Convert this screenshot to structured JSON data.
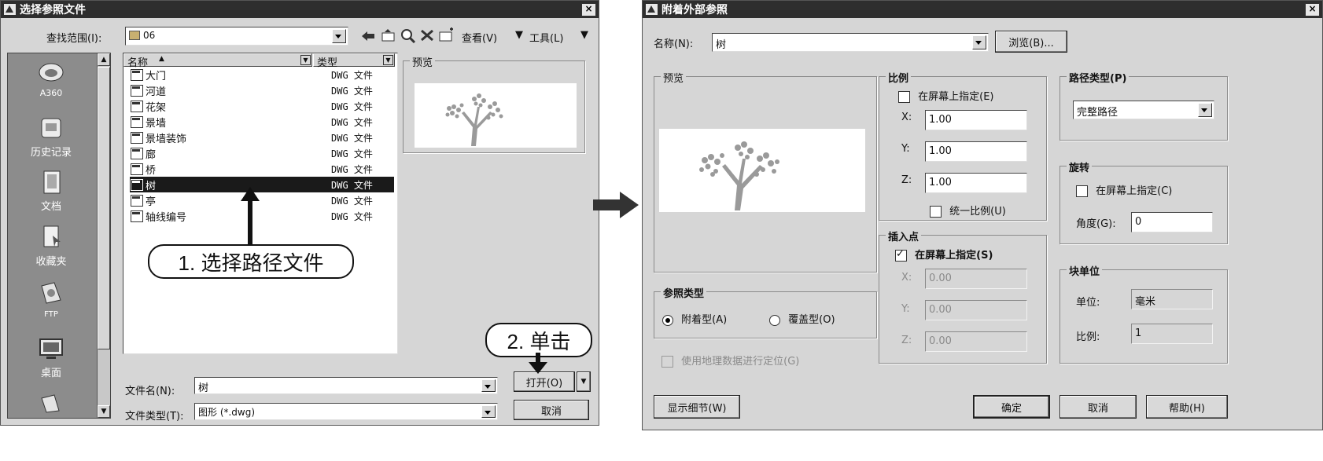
{
  "left_dialog": {
    "title": "选择参照文件",
    "close": "×",
    "lookin_label": "查找范围(I):",
    "lookin_value": "06",
    "view_menu": "查看(V)",
    "tools_menu": "工具(L)",
    "places": [
      "A360",
      "历史记录",
      "文档",
      "收藏夹",
      "FTP",
      "桌面"
    ],
    "col_name": "名称",
    "col_type": "类型",
    "files": [
      {
        "name": "大门",
        "type": "DWG 文件"
      },
      {
        "name": "河道",
        "type": "DWG 文件"
      },
      {
        "name": "花架",
        "type": "DWG 文件"
      },
      {
        "name": "景墙",
        "type": "DWG 文件"
      },
      {
        "name": "景墙装饰",
        "type": "DWG 文件"
      },
      {
        "name": "廊",
        "type": "DWG 文件"
      },
      {
        "name": "桥",
        "type": "DWG 文件"
      },
      {
        "name": "树",
        "type": "DWG 文件",
        "selected": true
      },
      {
        "name": "亭",
        "type": "DWG 文件"
      },
      {
        "name": "轴线编号",
        "type": "DWG 文件"
      }
    ],
    "preview_label": "预览",
    "filename_label": "文件名(N):",
    "filename_value": "树",
    "filetype_label": "文件类型(T):",
    "filetype_value": "图形 (*.dwg)",
    "open_button": "打开(O)",
    "cancel_button": "取消"
  },
  "callouts": {
    "step1": "1. 选择路径文件",
    "step2": "2. 单击"
  },
  "right_dialog": {
    "title": "附着外部参照",
    "close": "×",
    "name_label": "名称(N):",
    "name_value": "树",
    "browse_button": "浏览(B)...",
    "preview_label": "预览",
    "scale_label": "比例",
    "scale_onscreen": "在屏幕上指定(E)",
    "x_label": "X:",
    "x_value": "1.00",
    "y_label": "Y:",
    "y_value": "1.00",
    "z_label": "Z:",
    "z_value": "1.00",
    "uniform_scale": "统一比例(U)",
    "insert_label": "插入点",
    "insert_onscreen": "在屏幕上指定(S)",
    "ix_label": "X:",
    "ix_value": "0.00",
    "iy_label": "Y:",
    "iy_value": "0.00",
    "iz_label": "Z:",
    "iz_value": "0.00",
    "path_type_label": "路径类型(P)",
    "path_type_value": "完整路径",
    "rotation_label": "旋转",
    "rotation_onscreen": "在屏幕上指定(C)",
    "angle_label": "角度(G):",
    "angle_value": "0",
    "block_unit_label": "块单位",
    "unit_label": "单位:",
    "unit_value": "毫米",
    "ratio_label": "比例:",
    "ratio_value": "1",
    "ref_type_label": "参照类型",
    "attach_option": "附着型(A)",
    "overlay_option": "覆盖型(O)",
    "geo_option": "使用地理数据进行定位(G)",
    "details_button": "显示细节(W)",
    "ok_button": "确定",
    "cancel_button": "取消",
    "help_button": "帮助(H)"
  }
}
